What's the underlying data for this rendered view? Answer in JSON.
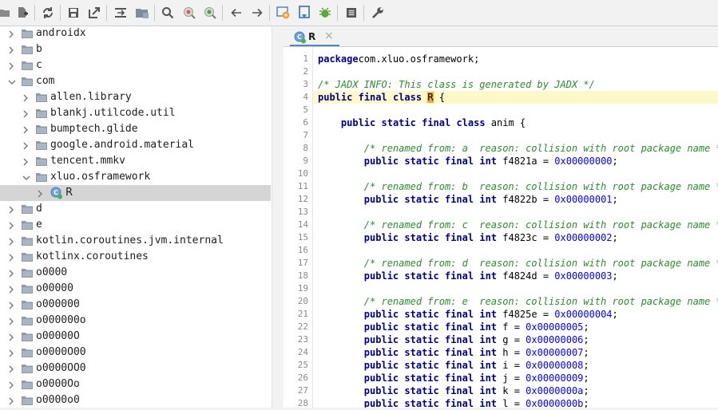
{
  "toolbar": {
    "icons": [
      "open-file-icon",
      "add-files-icon",
      "sync-icon",
      "save-icon",
      "export-icon",
      "sync-with-editor-icon",
      "flatten-packages-icon",
      "search-icon",
      "class-search-icon",
      "find-usages-icon",
      "back-icon",
      "forward-icon",
      "deobfuscation-icon",
      "decompile-icon",
      "debug-icon",
      "log-icon",
      "preferences-icon"
    ]
  },
  "tree": {
    "rows": [
      {
        "label": "androidx",
        "depth": 0,
        "expanded": false,
        "icon": "package"
      },
      {
        "label": "b",
        "depth": 0,
        "expanded": false,
        "icon": "package"
      },
      {
        "label": "c",
        "depth": 0,
        "expanded": false,
        "icon": "package"
      },
      {
        "label": "com",
        "depth": 0,
        "expanded": true,
        "icon": "package"
      },
      {
        "label": "allen.library",
        "depth": 1,
        "expanded": false,
        "icon": "package"
      },
      {
        "label": "blankj.utilcode.util",
        "depth": 1,
        "expanded": false,
        "icon": "package"
      },
      {
        "label": "bumptech.glide",
        "depth": 1,
        "expanded": false,
        "icon": "package"
      },
      {
        "label": "google.android.material",
        "depth": 1,
        "expanded": false,
        "icon": "package"
      },
      {
        "label": "tencent.mmkv",
        "depth": 1,
        "expanded": false,
        "icon": "package"
      },
      {
        "label": "xluo.osframework",
        "depth": 1,
        "expanded": true,
        "icon": "package"
      },
      {
        "label": "R",
        "depth": 2,
        "expanded": false,
        "icon": "class",
        "selected": true
      },
      {
        "label": "d",
        "depth": 0,
        "expanded": false,
        "icon": "package"
      },
      {
        "label": "e",
        "depth": 0,
        "expanded": false,
        "icon": "package"
      },
      {
        "label": "kotlin.coroutines.jvm.internal",
        "depth": 0,
        "expanded": false,
        "icon": "package"
      },
      {
        "label": "kotlinx.coroutines",
        "depth": 0,
        "expanded": false,
        "icon": "package"
      },
      {
        "label": "o0000",
        "depth": 0,
        "expanded": false,
        "icon": "package"
      },
      {
        "label": "o00000",
        "depth": 0,
        "expanded": false,
        "icon": "package"
      },
      {
        "label": "o000000",
        "depth": 0,
        "expanded": false,
        "icon": "package"
      },
      {
        "label": "o000000o",
        "depth": 0,
        "expanded": false,
        "icon": "package"
      },
      {
        "label": "o00000O",
        "depth": 0,
        "expanded": false,
        "icon": "package"
      },
      {
        "label": "o0000O00",
        "depth": 0,
        "expanded": false,
        "icon": "package"
      },
      {
        "label": "o0000OO0",
        "depth": 0,
        "expanded": false,
        "icon": "package"
      },
      {
        "label": "o0000Oo",
        "depth": 0,
        "expanded": false,
        "icon": "package"
      },
      {
        "label": "o0000o0",
        "depth": 0,
        "expanded": false,
        "icon": "package"
      }
    ]
  },
  "editor": {
    "tab": {
      "label": "R",
      "close": "×"
    },
    "lines": [
      {
        "n": "1",
        "segs": [
          [
            "kw",
            "package"
          ],
          [
            "",
            "com.xluo.osframework;"
          ]
        ]
      },
      {
        "n": "2",
        "segs": []
      },
      {
        "n": "3",
        "segs": [
          [
            "cm",
            "/* JADX INFO: This class is generated by JADX */"
          ]
        ]
      },
      {
        "n": "4",
        "hl": true,
        "segs": [
          [
            "kw",
            "public"
          ],
          [
            "",
            " "
          ],
          [
            "kw",
            "final"
          ],
          [
            "",
            " "
          ],
          [
            "kw",
            "class"
          ],
          [
            "",
            " "
          ],
          [
            "cur",
            "R"
          ],
          [
            "",
            " {"
          ]
        ]
      },
      {
        "n": "5",
        "segs": []
      },
      {
        "n": "6",
        "segs": [
          [
            "",
            "    "
          ],
          [
            "kw",
            "public"
          ],
          [
            "",
            " "
          ],
          [
            "kw",
            "static"
          ],
          [
            "",
            " "
          ],
          [
            "kw",
            "final"
          ],
          [
            "",
            " "
          ],
          [
            "kw",
            "class"
          ],
          [
            "",
            " anim {"
          ]
        ]
      },
      {
        "n": "7",
        "segs": []
      },
      {
        "n": "8",
        "segs": [
          [
            "",
            "        "
          ],
          [
            "cm",
            "/* renamed from: a  reason: collision with root package name */"
          ]
        ]
      },
      {
        "n": "9",
        "segs": [
          [
            "",
            "        "
          ],
          [
            "kw",
            "public"
          ],
          [
            "",
            " "
          ],
          [
            "kw",
            "static"
          ],
          [
            "",
            " "
          ],
          [
            "kw",
            "final"
          ],
          [
            "",
            " "
          ],
          [
            "kw",
            "int"
          ],
          [
            "",
            " f4821a = "
          ],
          [
            "num",
            "0x00000000"
          ],
          [
            "",
            ";"
          ]
        ]
      },
      {
        "n": "10",
        "segs": []
      },
      {
        "n": "11",
        "segs": [
          [
            "",
            "        "
          ],
          [
            "cm",
            "/* renamed from: b  reason: collision with root package name */"
          ]
        ]
      },
      {
        "n": "12",
        "segs": [
          [
            "",
            "        "
          ],
          [
            "kw",
            "public"
          ],
          [
            "",
            " "
          ],
          [
            "kw",
            "static"
          ],
          [
            "",
            " "
          ],
          [
            "kw",
            "final"
          ],
          [
            "",
            " "
          ],
          [
            "kw",
            "int"
          ],
          [
            "",
            " f4822b = "
          ],
          [
            "num",
            "0x00000001"
          ],
          [
            "",
            ";"
          ]
        ]
      },
      {
        "n": "13",
        "segs": []
      },
      {
        "n": "14",
        "segs": [
          [
            "",
            "        "
          ],
          [
            "cm",
            "/* renamed from: c  reason: collision with root package name */"
          ]
        ]
      },
      {
        "n": "15",
        "segs": [
          [
            "",
            "        "
          ],
          [
            "kw",
            "public"
          ],
          [
            "",
            " "
          ],
          [
            "kw",
            "static"
          ],
          [
            "",
            " "
          ],
          [
            "kw",
            "final"
          ],
          [
            "",
            " "
          ],
          [
            "kw",
            "int"
          ],
          [
            "",
            " f4823c = "
          ],
          [
            "num",
            "0x00000002"
          ],
          [
            "",
            ";"
          ]
        ]
      },
      {
        "n": "16",
        "segs": []
      },
      {
        "n": "17",
        "segs": [
          [
            "",
            "        "
          ],
          [
            "cm",
            "/* renamed from: d  reason: collision with root package name */"
          ]
        ]
      },
      {
        "n": "18",
        "segs": [
          [
            "",
            "        "
          ],
          [
            "kw",
            "public"
          ],
          [
            "",
            " "
          ],
          [
            "kw",
            "static"
          ],
          [
            "",
            " "
          ],
          [
            "kw",
            "final"
          ],
          [
            "",
            " "
          ],
          [
            "kw",
            "int"
          ],
          [
            "",
            " f4824d = "
          ],
          [
            "num",
            "0x00000003"
          ],
          [
            "",
            ";"
          ]
        ]
      },
      {
        "n": "19",
        "segs": []
      },
      {
        "n": "20",
        "segs": [
          [
            "",
            "        "
          ],
          [
            "cm",
            "/* renamed from: e  reason: collision with root package name */"
          ]
        ]
      },
      {
        "n": "21",
        "segs": [
          [
            "",
            "        "
          ],
          [
            "kw",
            "public"
          ],
          [
            "",
            " "
          ],
          [
            "kw",
            "static"
          ],
          [
            "",
            " "
          ],
          [
            "kw",
            "final"
          ],
          [
            "",
            " "
          ],
          [
            "kw",
            "int"
          ],
          [
            "",
            " f4825e = "
          ],
          [
            "num",
            "0x00000004"
          ],
          [
            "",
            ";"
          ]
        ]
      },
      {
        "n": "22",
        "segs": [
          [
            "",
            "        "
          ],
          [
            "kw",
            "public"
          ],
          [
            "",
            " "
          ],
          [
            "kw",
            "static"
          ],
          [
            "",
            " "
          ],
          [
            "kw",
            "final"
          ],
          [
            "",
            " "
          ],
          [
            "kw",
            "int"
          ],
          [
            "",
            " f = "
          ],
          [
            "num",
            "0x00000005"
          ],
          [
            "",
            ";"
          ]
        ]
      },
      {
        "n": "23",
        "segs": [
          [
            "",
            "        "
          ],
          [
            "kw",
            "public"
          ],
          [
            "",
            " "
          ],
          [
            "kw",
            "static"
          ],
          [
            "",
            " "
          ],
          [
            "kw",
            "final"
          ],
          [
            "",
            " "
          ],
          [
            "kw",
            "int"
          ],
          [
            "",
            " g = "
          ],
          [
            "num",
            "0x00000006"
          ],
          [
            "",
            ";"
          ]
        ]
      },
      {
        "n": "24",
        "segs": [
          [
            "",
            "        "
          ],
          [
            "kw",
            "public"
          ],
          [
            "",
            " "
          ],
          [
            "kw",
            "static"
          ],
          [
            "",
            " "
          ],
          [
            "kw",
            "final"
          ],
          [
            "",
            " "
          ],
          [
            "kw",
            "int"
          ],
          [
            "",
            " h = "
          ],
          [
            "num",
            "0x00000007"
          ],
          [
            "",
            ";"
          ]
        ]
      },
      {
        "n": "25",
        "segs": [
          [
            "",
            "        "
          ],
          [
            "kw",
            "public"
          ],
          [
            "",
            " "
          ],
          [
            "kw",
            "static"
          ],
          [
            "",
            " "
          ],
          [
            "kw",
            "final"
          ],
          [
            "",
            " "
          ],
          [
            "kw",
            "int"
          ],
          [
            "",
            " i = "
          ],
          [
            "num",
            "0x00000008"
          ],
          [
            "",
            ";"
          ]
        ]
      },
      {
        "n": "26",
        "segs": [
          [
            "",
            "        "
          ],
          [
            "kw",
            "public"
          ],
          [
            "",
            " "
          ],
          [
            "kw",
            "static"
          ],
          [
            "",
            " "
          ],
          [
            "kw",
            "final"
          ],
          [
            "",
            " "
          ],
          [
            "kw",
            "int"
          ],
          [
            "",
            " j = "
          ],
          [
            "num",
            "0x00000009"
          ],
          [
            "",
            ";"
          ]
        ]
      },
      {
        "n": "27",
        "segs": [
          [
            "",
            "        "
          ],
          [
            "kw",
            "public"
          ],
          [
            "",
            " "
          ],
          [
            "kw",
            "static"
          ],
          [
            "",
            " "
          ],
          [
            "kw",
            "final"
          ],
          [
            "",
            " "
          ],
          [
            "kw",
            "int"
          ],
          [
            "",
            " k = "
          ],
          [
            "num",
            "0x0000000a"
          ],
          [
            "",
            ";"
          ]
        ]
      },
      {
        "n": "28",
        "segs": [
          [
            "",
            "        "
          ],
          [
            "kw",
            "public"
          ],
          [
            "",
            " "
          ],
          [
            "kw",
            "static"
          ],
          [
            "",
            " "
          ],
          [
            "kw",
            "final"
          ],
          [
            "",
            " "
          ],
          [
            "kw",
            "int"
          ],
          [
            "",
            " l = "
          ],
          [
            "num",
            "0x0000000b"
          ],
          [
            "",
            ";"
          ]
        ]
      }
    ]
  }
}
